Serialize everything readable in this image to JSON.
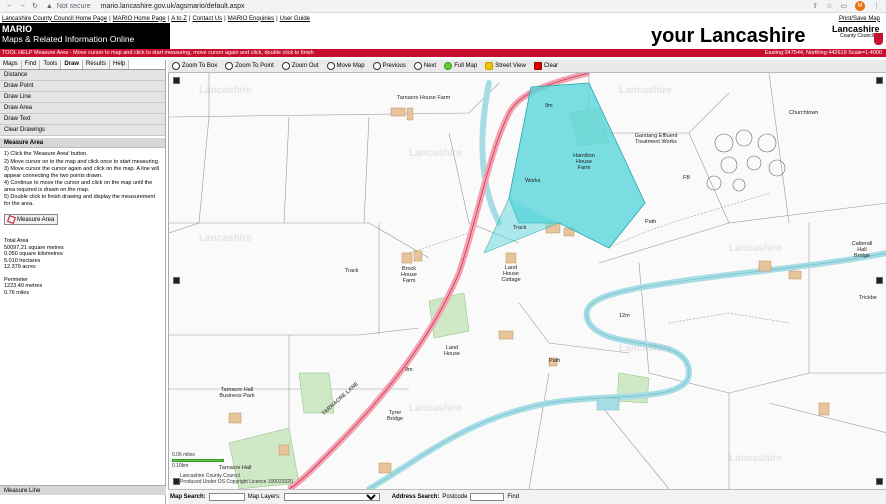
{
  "browser": {
    "security": "Not secure",
    "url": "mario.lancashire.gov.uk/agsmario/default.aspx",
    "avatar": "M"
  },
  "toplinks": [
    "Lancashire County Council Home Page",
    "MARIO Home Page",
    "A to Z",
    "Contact Us",
    "MARIO Enquiries",
    "User Guide"
  ],
  "toplinks_right": "Print/Save Map",
  "banner": {
    "app": "MARIO",
    "subtitle": "Maps & Related Information Online",
    "your": "your Lancashire",
    "logo": "Lancashire",
    "logo_sub": "County Council"
  },
  "redbar": {
    "tip": "TOOL HELP Measure Area - Move cursor to map and click to start measuring, move cursor again and click, double click to finish",
    "coords": "Easting:347544, Northing:442619 Scale=1:4000"
  },
  "tabs": [
    "Maps",
    "Find",
    "Tools",
    "Draw",
    "Results",
    "Help"
  ],
  "menu": [
    "Distance",
    "Draw Point",
    "Draw Line",
    "Draw Area",
    "Draw Text",
    "Clear Drawings"
  ],
  "measure": {
    "title": "Measure Area",
    "steps": [
      "1) Click the 'Measure Area' button.",
      "2) Move cursor on to the map and click once to start measuring.",
      "3) Move cursor the cursor again and click on the map. A line will appear connecting the two points drawn.",
      "4) Continue to move the cursor and click on the map until the area required is drawn on the map.",
      "5) Double click to finish drawing and display the measurement for the area."
    ],
    "button": "Measure Area",
    "total_label": "Total Area",
    "total": [
      "50097.21 square metres",
      "0.050 square kilometres",
      "5.010 hectares",
      "12.379 acres"
    ],
    "perim_label": "Perimeter",
    "perim": [
      "1223.40 metres",
      "0.76 miles"
    ]
  },
  "sidebar_bottom": "Measure Line",
  "toolbar": [
    "Zoom To Box",
    "Zoom To Point",
    "Zoom Out",
    "Move Map",
    "Previous",
    "Next",
    "Full Map",
    "Street View",
    "Clear"
  ],
  "map_labels": {
    "tarnacre_house": "Tarnacre House Farm",
    "hamilton": "Hamilton House Farm",
    "works": "Works",
    "garstang": "Garstang Effluent Treatment Works",
    "churchtown": "Churchtown",
    "fb": "FB",
    "path": "Path",
    "track": "Track",
    "brock": "Brock House Farm",
    "land_cottage": "Land House Cottage",
    "catterall": "Catterall Hall Bridge",
    "trickbe": "Trickbe",
    "land_house": "Land House",
    "tarnacre_hall": "Tarnacre Hall Business Park",
    "tyrer": "Tyrer Bridge",
    "tarnacre_hall2": "Tarnacre Hall",
    "lane": "TARNACRE LANE",
    "nine_m": "9m",
    "twelve_m": "12m",
    "wm": "Lancashire",
    "wm_sub": "County Council"
  },
  "scale": [
    "0.06 miles",
    "0.10km"
  ],
  "attribution": [
    "Lancashire County Council",
    "Produced Under OS Copyright Licence 100023320"
  ],
  "mapbottom": {
    "map_search": "Map Search:",
    "map_layers": "Map Layers:",
    "address_search": "Address Search:",
    "postcode": "Postcode",
    "find": "Find"
  },
  "colors": {
    "red": "#c8102e",
    "polygon": "#59d6dc",
    "river": "#a6dde5",
    "road": "#f2a1b0"
  }
}
